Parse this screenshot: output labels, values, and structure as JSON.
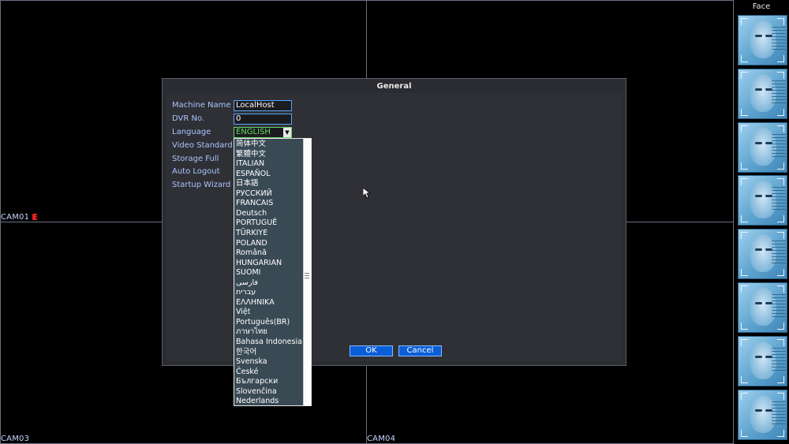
{
  "cameras": {
    "cam01": "CAM01",
    "cam03": "CAM03",
    "cam04": "CAM04"
  },
  "face_panel": {
    "title": "Face"
  },
  "dialog": {
    "title": "General",
    "fields": {
      "machine_name_label": "Machine Name",
      "machine_name_value": "LocalHost",
      "dvr_no_label": "DVR No.",
      "dvr_no_value": "0",
      "language_label": "Language",
      "language_value": "ENGLISH",
      "video_standard_label": "Video Standard",
      "storage_full_label": "Storage Full",
      "auto_logout_label": "Auto Logout",
      "startup_wizard_label": "Startup Wizard"
    },
    "ok_label": "OK",
    "cancel_label": "Cancel",
    "language_options": [
      "简体中文",
      "繁體中文",
      "ITALIAN",
      "ESPAÑOL",
      "日本語",
      "РУССКИЙ",
      "FRANCAIS",
      "Deutsch",
      "PORTUGUÊ",
      "TÜRKIYE",
      "POLAND",
      "Română",
      "HUNGARIAN",
      "SUOMI",
      "ﻓﺎﺭﺳﯽ",
      "עברית",
      "ΕΛΛΗΝΙΚΑ",
      "Việt",
      "Português(BR)",
      "ภาษาไทย",
      "Bahasa Indonesia",
      "한국어",
      "Svenska",
      "České",
      "Български",
      "Slovenčina",
      "Nederlands"
    ]
  },
  "colors": {
    "accent_blue": "#0a5ed8",
    "label_blue": "#a9c4ff",
    "selected_green": "#5fe05f",
    "record_red": "#ff2020"
  }
}
